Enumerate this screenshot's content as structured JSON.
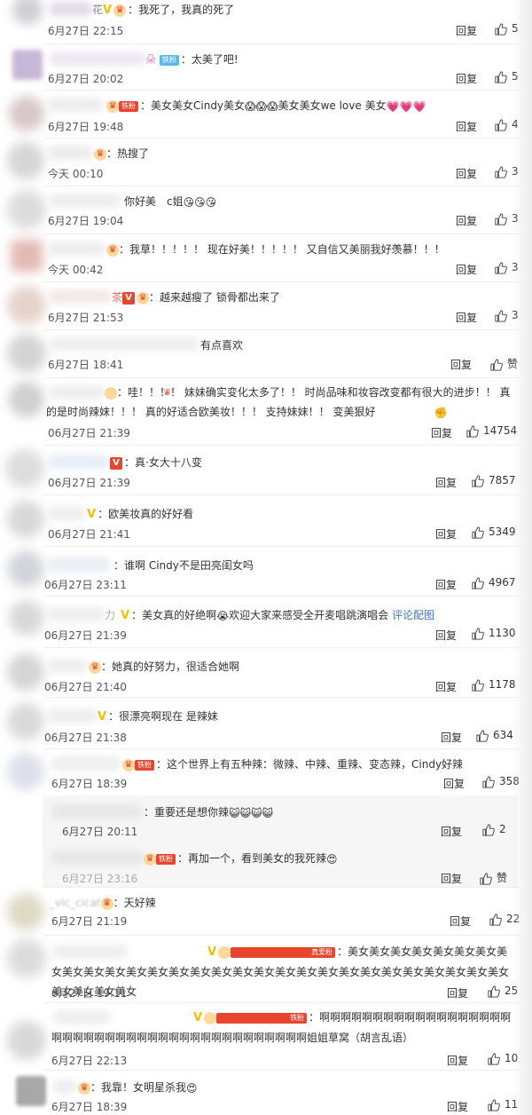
{
  "colors": {
    "accent": "#ff6d22",
    "link": "#3b78c9",
    "vip": "#f5a623"
  },
  "ui": {
    "reply_label": "回复",
    "thumb_icon": "thumb-up-icon"
  },
  "comments": [
    {
      "name": "花",
      "text": "：我死了，我真的死了",
      "time": "6月27日 22:15",
      "likes": "5"
    },
    {
      "name": "朵",
      "fan": "铁粉",
      "text": "：太美了吧!",
      "time": "6月27日 20:02",
      "likes": "5"
    },
    {
      "fan": "铁粉",
      "text": "：美女美女Cindy美女",
      "text2": "美女美女we love 美女",
      "time": "6月27日 19:48",
      "likes": "4"
    },
    {
      "text": "：热搜了",
      "time": "今天 00:10",
      "likes": "3"
    },
    {
      "text": "你好美　c姐",
      "time": "6月27日 19:04",
      "likes": "3"
    },
    {
      "text": "：我草！！！！！ 现在好美！！！！！ 又自信又美丽我好羡慕！！！",
      "time": "今天 00:42",
      "likes": "3"
    },
    {
      "name": "茶",
      "text": "：越来越瘦了 锁骨都出来了",
      "time": "6月27日 21:53",
      "likes": "3"
    },
    {
      "text": "有点喜欢",
      "time": "6月27日 18:41",
      "likes": "赞"
    },
    {
      "text": "：哇！！！！ 妹妹确实变化太多了！！ 时尚品味和妆容改变都有很大的进步！！ 真的是时尚辣妹！！！ 真的好适合欧美妆！！！ 支持妹妹！！ 变美狠好",
      "time": "06月27日 21:39",
      "likes": "14754"
    },
    {
      "text": "：真·女大十八变",
      "time": "06月27日 21:39",
      "likes": "7857"
    },
    {
      "text": "：欧美妆真的好好看",
      "time": "06月27日 21:41",
      "likes": "5349"
    },
    {
      "text": "：谁啊 Cindy不是田亮闺女吗",
      "time": "06月27日 23:11",
      "likes": "4967"
    },
    {
      "name": "力",
      "text": "：美女真的好绝啊",
      "text2": "欢迎大家来感受全开麦唱跳演唱会",
      "link": "评论配图",
      "time": "06月27日 21:39",
      "likes": "1130"
    },
    {
      "text": "：她真的好努力，很适合她啊",
      "time": "06月27日 21:40",
      "likes": "1178"
    },
    {
      "text": "：很漂亮啊现在 是辣妹",
      "time": "06月27日 21:38",
      "likes": "634"
    },
    {
      "fan": "铁粉",
      "text": "：这个世界上有五种辣：微辣、中辣、重辣、变态辣，Cindy好辣",
      "time": "6月27日 18:39",
      "likes": "358"
    },
    {
      "text": "：重要还是想你辣",
      "time": "6月27日 20:11",
      "likes": "2"
    },
    {
      "fan": "铁粉",
      "text": "：再加一个，看到美女的我死辣",
      "time": "6月27日 23:16",
      "likes": "赞"
    },
    {
      "name": "_vic_cicat",
      "text": "：天好辣",
      "time": "6月27日 21:19",
      "likes": "22"
    },
    {
      "fan": "真爱粉",
      "text": "：美女美女美女美女美女美女美女美女美女美女美女美女美女美女美女美女美女美女美女美女美女美女美女美女美女美女美女美女美女美女美女美女美女",
      "time": "6月27日 19:11",
      "likes": "25"
    },
    {
      "fan": "铁粉",
      "text": "：啊啊啊啊啊啊啊啊啊啊啊啊啊啊啊啊啊啊啊啊啊啊啊啊啊啊啊啊啊啊啊啊啊啊啊啊啊啊啊啊啊啊姐姐草窝（胡言乱语）",
      "time": "6月27日 22:13",
      "likes": "10"
    },
    {
      "text": "：我靠！女明星杀我",
      "time": "6月27日 18:39",
      "likes": "11"
    }
  ]
}
